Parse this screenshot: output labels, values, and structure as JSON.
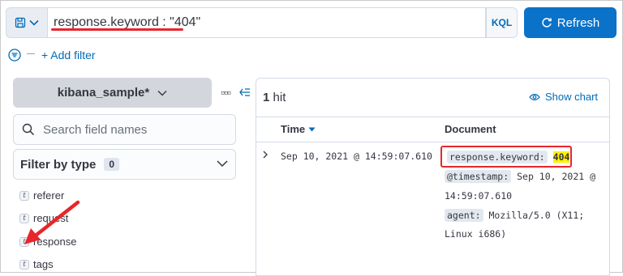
{
  "query_bar": {
    "save_icon": "save-icon",
    "query_text": "response.keyword : \"404\"",
    "language_label": "KQL",
    "refresh_label": "Refresh",
    "refresh_icon": "refresh-icon"
  },
  "filters": {
    "add_filter_label": "+ Add filter"
  },
  "sidebar": {
    "index_pattern": "kibana_sample*",
    "search_placeholder": "Search field names",
    "filter_by_type_label": "Filter by type",
    "filter_count": "0",
    "fields": [
      {
        "type": "t",
        "name": "referer"
      },
      {
        "type": "t",
        "name": "request"
      },
      {
        "type": "t",
        "name": "response"
      },
      {
        "type": "t",
        "name": "tags"
      }
    ]
  },
  "results": {
    "hit_count": "1",
    "hit_label": "hit",
    "show_chart_label": "Show chart",
    "columns": {
      "time": "Time",
      "document": "Document"
    },
    "row": {
      "time": "Sep 10, 2021 @ 14:59:07.610",
      "doc": {
        "key1": "response.keyword:",
        "val1": "404",
        "key2": "@timestamp:",
        "val2a": "Sep 10, 2021 @",
        "val2b": "14:59:07.610",
        "key3": "agent:",
        "val3a": "Mozilla/5.0 (X11;",
        "val3b": "Linux i686)"
      }
    }
  },
  "colors": {
    "accent": "#006bb8",
    "primary_button": "#0a72c9",
    "annotation_red": "#e7262b",
    "highlight": "#fff200"
  }
}
